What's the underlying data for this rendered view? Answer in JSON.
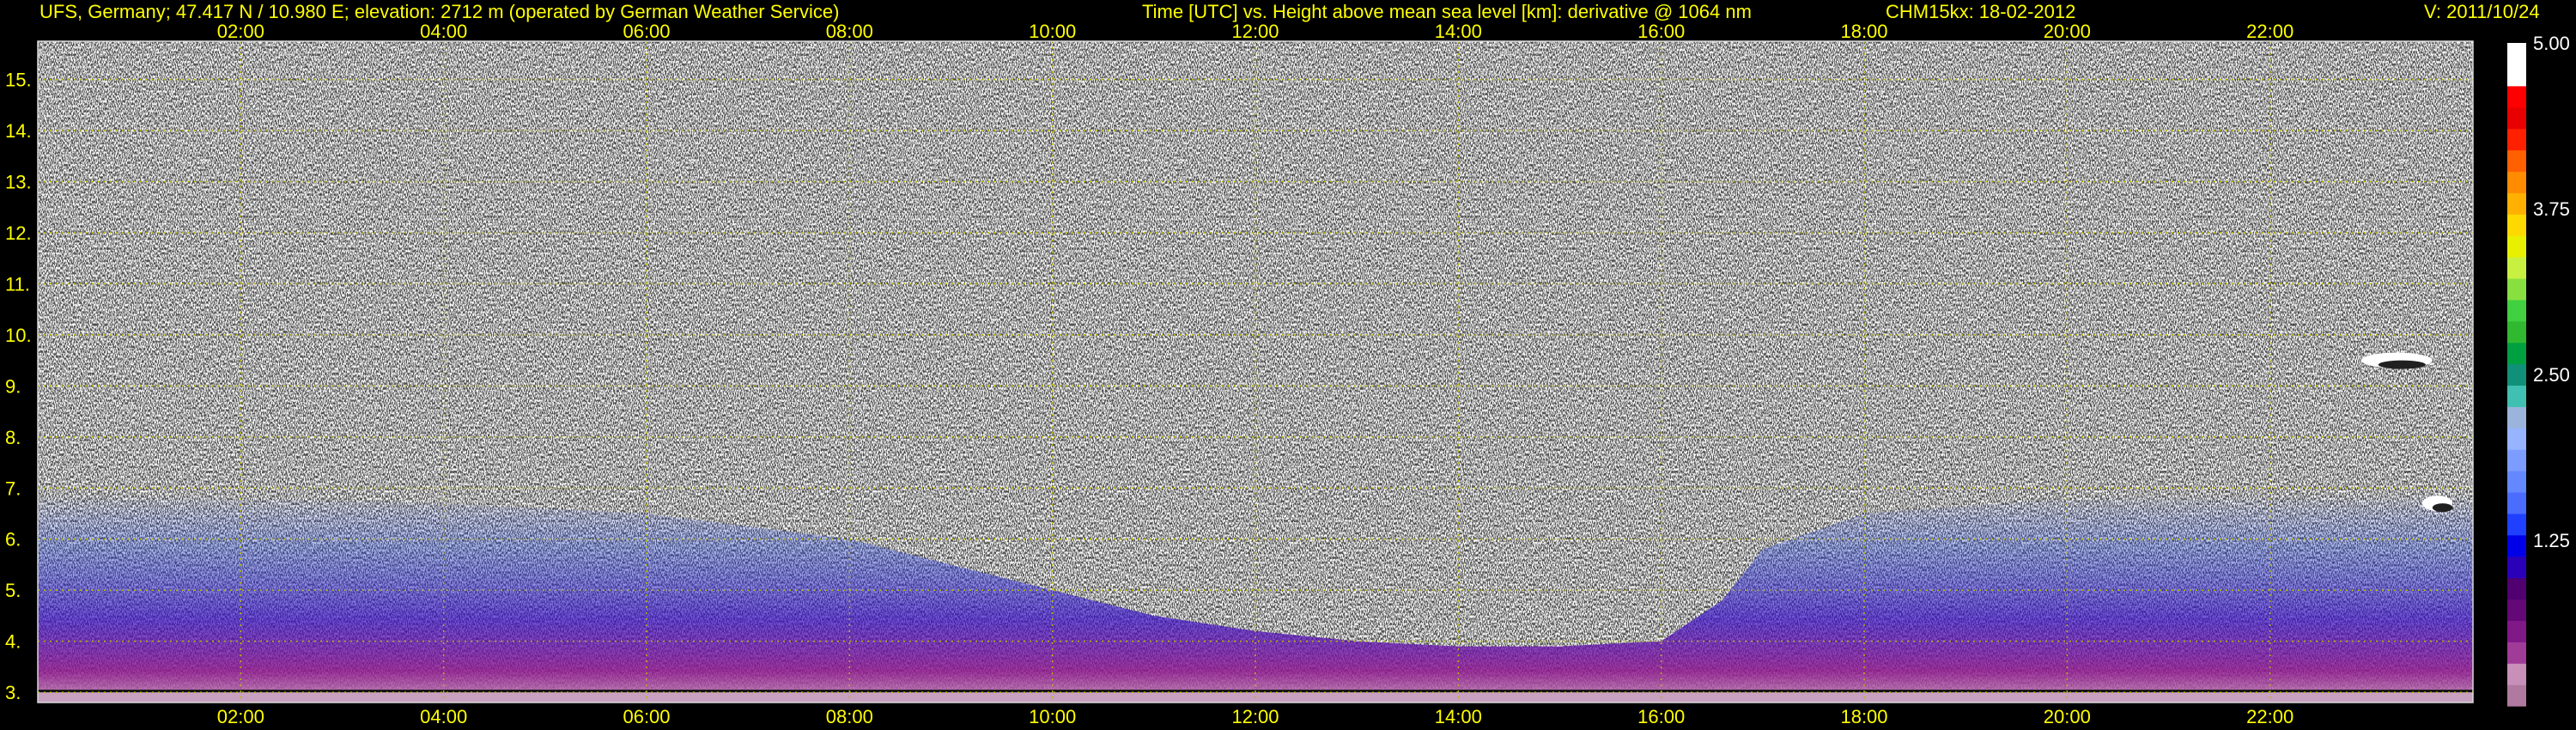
{
  "header": {
    "station": "UFS, Germany; 47.417 N / 10.980 E; elevation: 2712 m  (operated by German Weather Service)",
    "axes_description": "Time [UTC] vs. Height above mean sea level [km]: derivative @ 1064 nm",
    "instrument_date": "CHM15kx: 18-02-2012",
    "version": "V: 2011/10/24"
  },
  "colors": {
    "text": "#ffff00",
    "grid": "#b8b800",
    "colorbar_text": "#ffffff",
    "background": "#000000"
  },
  "chart_data": {
    "type": "heatmap",
    "x_range_hours": [
      0,
      24
    ],
    "x_ticks": [
      "02:00",
      "04:00",
      "06:00",
      "08:00",
      "10:00",
      "12:00",
      "14:00",
      "16:00",
      "18:00",
      "20:00",
      "22:00"
    ],
    "x_tick_hours": [
      2,
      4,
      6,
      8,
      10,
      12,
      14,
      16,
      18,
      20,
      22
    ],
    "y_range_km": [
      2.8,
      15.75
    ],
    "y_ticks": [
      "3.",
      "4.",
      "5.",
      "6.",
      "7.",
      "8.",
      "9.",
      "10.",
      "11.",
      "12.",
      "13.",
      "14.",
      "15."
    ],
    "y_tick_values": [
      3,
      4,
      5,
      6,
      7,
      8,
      9,
      10,
      11,
      12,
      13,
      14,
      15
    ],
    "grid": true,
    "colorbar": {
      "range": [
        0,
        5
      ],
      "tick_labels": [
        "5.00",
        "3.75",
        "2.50",
        "1.25"
      ],
      "tick_values": [
        5.0,
        3.75,
        2.5,
        1.25
      ],
      "colors": [
        "#b07aa0",
        "#c890b8",
        "#a03c98",
        "#801888",
        "#640878",
        "#500070",
        "#2a00b8",
        "#0000e8",
        "#2040ff",
        "#4a6cff",
        "#6488ff",
        "#7c9cff",
        "#96b4ff",
        "#9ab4dc",
        "#40c0b0",
        "#109078",
        "#00a040",
        "#30b830",
        "#40d040",
        "#88e040",
        "#c8f040",
        "#e8f000",
        "#ffd800",
        "#ffb000",
        "#ff8c00",
        "#ff6000",
        "#ff2000",
        "#e80000",
        "#ff0000",
        "#ffffff",
        "#ffffff"
      ]
    },
    "aerosol_layer_top_km": [
      [
        0,
        6.9
      ],
      [
        2,
        6.8
      ],
      [
        4,
        6.7
      ],
      [
        6,
        6.5
      ],
      [
        8,
        6.0
      ],
      [
        9,
        5.5
      ],
      [
        10,
        5.0
      ],
      [
        11,
        4.5
      ],
      [
        12,
        4.2
      ],
      [
        13,
        4.0
      ],
      [
        14,
        3.9
      ],
      [
        15,
        3.9
      ],
      [
        16,
        4.0
      ],
      [
        16.6,
        4.8
      ],
      [
        17,
        5.8
      ],
      [
        18,
        6.5
      ],
      [
        20,
        6.8
      ],
      [
        22,
        6.9
      ],
      [
        24,
        6.9
      ]
    ],
    "ground_layer_km": 3.0,
    "cloud_patches": [
      {
        "hour_start": 22.9,
        "hour_end": 23.6,
        "height_km": 9.5
      },
      {
        "hour_start": 23.5,
        "hour_end": 23.8,
        "height_km": 6.7
      }
    ]
  }
}
